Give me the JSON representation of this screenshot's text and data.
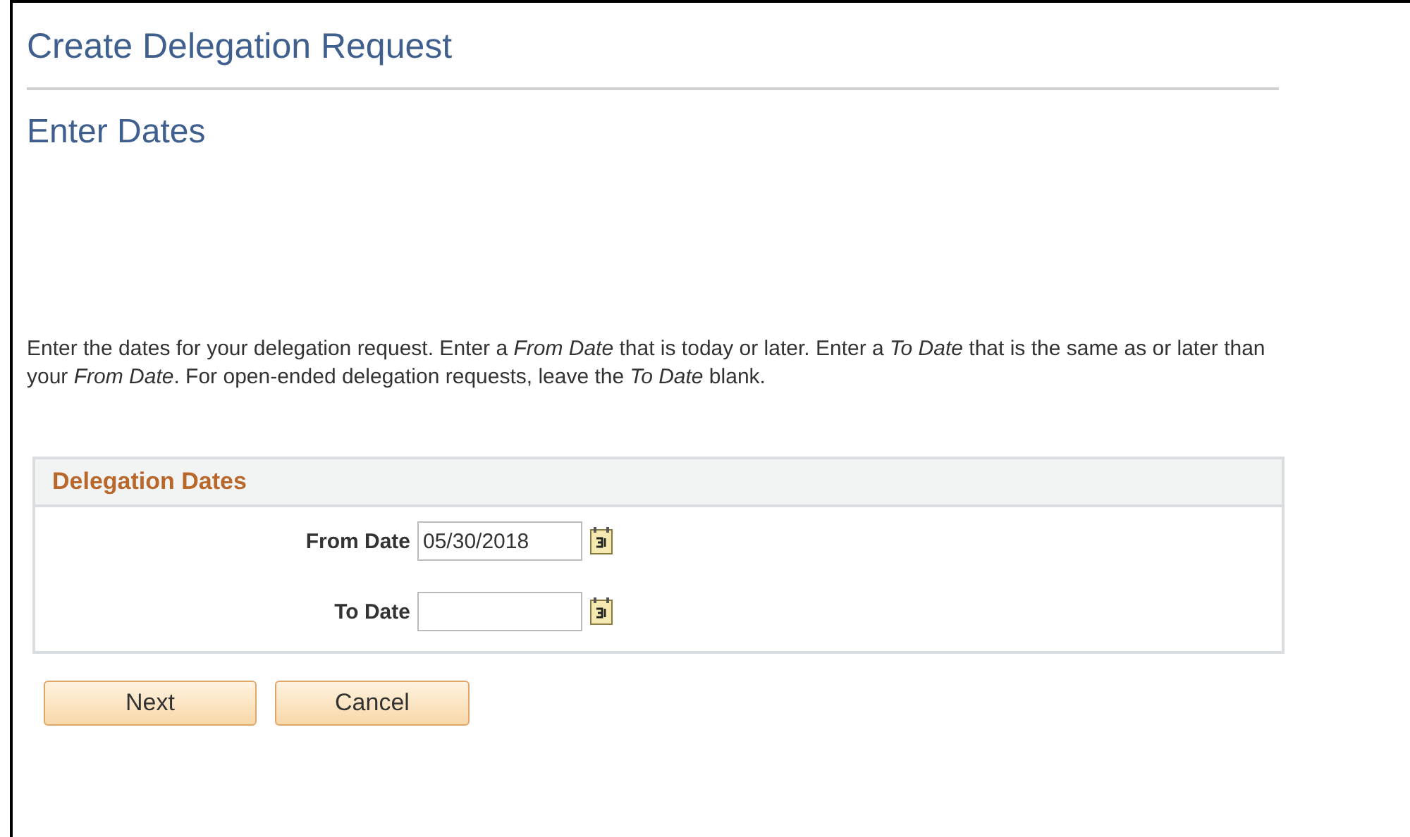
{
  "page_title": "Create Delegation Request",
  "step_title": "Enter Dates",
  "instructions": "Enter the dates for your delegation request. Enter a *From Date* that is today or later. Enter a *To Date* that is the same as or later than your *From Date*. For open-ended delegation requests, leave the *To Date* blank.",
  "group": {
    "title": "Delegation Dates",
    "fields": [
      {
        "label": "From Date",
        "value": "05/30/2018"
      },
      {
        "label": "To Date"
      }
    ]
  },
  "buttons": [
    "Next",
    "Cancel"
  ]
}
